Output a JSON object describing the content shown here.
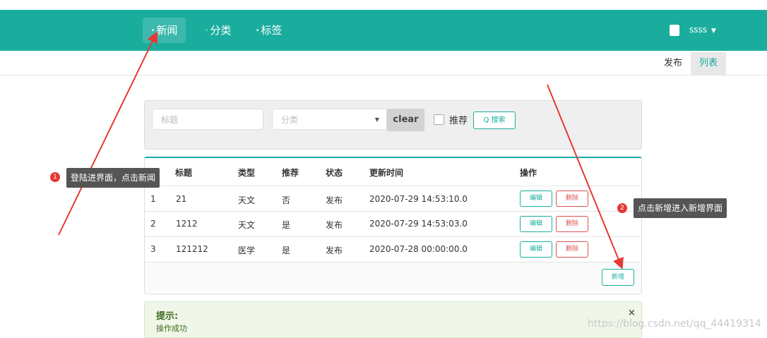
{
  "nav": {
    "items": [
      {
        "label": "新闻"
      },
      {
        "label": "分类"
      },
      {
        "label": "标签"
      }
    ],
    "user": "ssss"
  },
  "subtabs": [
    {
      "label": "发布"
    },
    {
      "label": "列表"
    }
  ],
  "search": {
    "title_placeholder": "标题",
    "category_placeholder": "分类",
    "clear_label": "clear",
    "recommend_label": "推荐",
    "search_label": "Q 搜索"
  },
  "table": {
    "headers": [
      "标题",
      "类型",
      "推荐",
      "状态",
      "更新时间",
      "操作"
    ],
    "rows": [
      {
        "id": "1",
        "title": "21",
        "type": "天文",
        "rec": "否",
        "status": "发布",
        "time": "2020-07-29 14:53:10.0"
      },
      {
        "id": "2",
        "title": "1212",
        "type": "天文",
        "rec": "是",
        "status": "发布",
        "time": "2020-07-29 14:53:03.0"
      },
      {
        "id": "3",
        "title": "121212",
        "type": "医学",
        "rec": "是",
        "status": "发布",
        "time": "2020-07-28 00:00:00.0"
      }
    ],
    "edit_label": "编辑",
    "delete_label": "删除",
    "add_label": "新增"
  },
  "alert": {
    "title": "提示:",
    "message": "操作成功",
    "close": "×"
  },
  "annotations": [
    {
      "num": "1",
      "text": "登陆进界面，点击新闻"
    },
    {
      "num": "2",
      "text": "点击新增进入新增界面"
    }
  ],
  "watermark": "https://blog.csdn.net/qq_44419314",
  "colors": {
    "accent": "#1aad9e",
    "danger": "#d9534f",
    "annotation_arrow": "#e53935"
  }
}
